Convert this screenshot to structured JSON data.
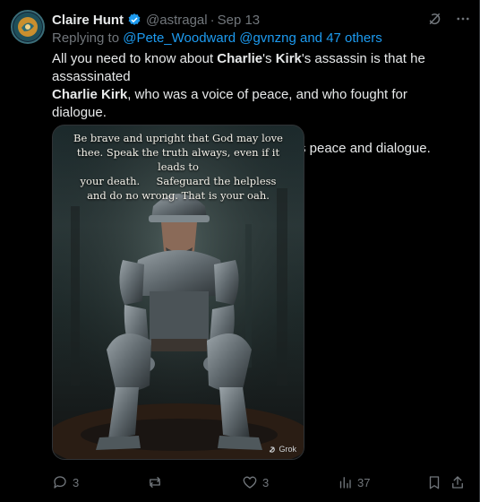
{
  "post": {
    "author": {
      "name": "Claire Hunt",
      "handle": "@astragal",
      "avatar_icon": "emblem-avatar-icon"
    },
    "separator": "·",
    "date": "Sep 13",
    "replying": {
      "prefix": "Replying to ",
      "mentions": "@Pete_Woodward @gvnzng and 47 others"
    },
    "text": {
      "line1_a": "All you need to know about ",
      "line1_b": "Charlie",
      "line1_c": "'s ",
      "line1_d": "Kirk",
      "line1_e": "'s assassin is that he assassinated",
      "line2_a": "Charlie Kirk",
      "line2_b": ", who was a voice of peace, and who fought for dialogue.",
      "para2": "This was the act of someone who opposes peace and dialogue."
    },
    "media": {
      "quote_lines": [
        "Be brave and upright that God may love",
        "thee. Speak the truth always, even if it leads to",
        "your death.     Safeguard the helpless",
        "and do no wrong. That is your oah."
      ],
      "watermark": "Grok"
    },
    "actions": {
      "replies": "3",
      "reposts": "",
      "likes": "3",
      "views": "37"
    },
    "colors": {
      "link": "#1d9bf0",
      "muted": "#71767b",
      "text": "#e7e9ea",
      "verified": "#1d9bf0"
    }
  }
}
